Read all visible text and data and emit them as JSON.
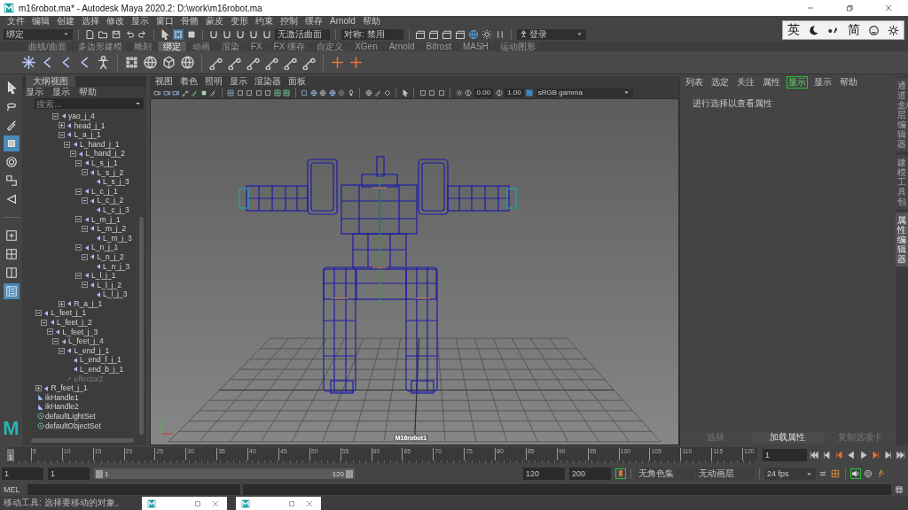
{
  "window": {
    "title": "m16robot.ma* - Autodesk Maya 2020.2: D:\\work\\m16robot.ma"
  },
  "menu_bar": [
    "文件",
    "编辑",
    "创建",
    "选择",
    "修改",
    "显示",
    "窗口",
    "骨骼",
    "蒙皮",
    "变形",
    "约束",
    "控制",
    "缓存",
    "Arnold",
    "帮助"
  ],
  "ime_toolbar": {
    "language": "英",
    "script": "简"
  },
  "status_line": {
    "menu_set": "绑定",
    "live_surface": "无激活曲面",
    "symmetry": "对称: 禁用",
    "login": "登录"
  },
  "shelf": {
    "tabs": [
      {
        "label": "曲线/曲面",
        "selected": false
      },
      {
        "label": "多边形建模",
        "selected": false
      },
      {
        "label": "雕刻",
        "selected": false
      },
      {
        "label": "绑定",
        "selected": true
      },
      {
        "label": "动画",
        "selected": false
      },
      {
        "label": "渲染",
        "selected": false
      },
      {
        "label": "FX",
        "selected": false
      },
      {
        "label": "FX 缓存",
        "selected": false
      },
      {
        "label": "自定义",
        "selected": false
      },
      {
        "label": "XGen",
        "selected": false
      },
      {
        "label": "Arnold",
        "selected": false
      },
      {
        "label": "Bifrost",
        "selected": false
      },
      {
        "label": "MASH",
        "selected": false
      },
      {
        "label": "运动图形",
        "selected": false
      }
    ]
  },
  "toolbox": {
    "tools": [
      {
        "selected": false
      },
      {
        "selected": false
      },
      {
        "selected": false
      },
      {
        "selected": true
      },
      {
        "selected": false
      },
      {
        "selected": false
      },
      {
        "selected": false
      }
    ],
    "layouts": [
      {
        "selected": false
      },
      {
        "selected": false
      },
      {
        "selected": false
      },
      {
        "selected": true
      }
    ],
    "logo": "M"
  },
  "outliner": {
    "title": "大纲视图",
    "menus": [
      "显示",
      "显示",
      "帮助"
    ],
    "search": {
      "placeholder": "搜索..."
    },
    "tree": [
      {
        "children": [
          {
            "children": [
              {
                "children": [
                  {
                    "children": [
                      {
                        "label": "yao_j_4",
                        "kind": "joint",
                        "expanded": true,
                        "children": [
                          {
                            "label": "head_j_1",
                            "kind": "joint",
                            "expanded": false
                          },
                          {
                            "label": "L_a_j_1",
                            "kind": "joint",
                            "expanded": true,
                            "children": [
                              {
                                "label": "L_hand_j_1",
                                "kind": "joint",
                                "expanded": true,
                                "children": [
                                  {
                                    "label": "L_hand_j_2",
                                    "kind": "joint",
                                    "expanded": true,
                                    "children": [
                                      {
                                        "label": "L_s_j_1",
                                        "kind": "joint",
                                        "expanded": true,
                                        "children": [
                                          {
                                            "label": "L_s_j_2",
                                            "kind": "joint",
                                            "expanded": true,
                                            "children": [
                                              {
                                                "label": "L_s_j_3",
                                                "kind": "joint"
                                              }
                                            ]
                                          }
                                        ]
                                      },
                                      {
                                        "label": "L_c_j_1",
                                        "kind": "joint",
                                        "expanded": true,
                                        "children": [
                                          {
                                            "label": "L_c_j_2",
                                            "kind": "joint",
                                            "expanded": true,
                                            "children": [
                                              {
                                                "label": "L_c_j_3",
                                                "kind": "joint"
                                              }
                                            ]
                                          }
                                        ]
                                      },
                                      {
                                        "label": "L_m_j_1",
                                        "kind": "joint",
                                        "expanded": true,
                                        "children": [
                                          {
                                            "label": "L_m_j_2",
                                            "kind": "joint",
                                            "expanded": true,
                                            "children": [
                                              {
                                                "label": "L_m_j_3",
                                                "kind": "joint"
                                              }
                                            ]
                                          }
                                        ]
                                      },
                                      {
                                        "label": "L_n_j_1",
                                        "kind": "joint",
                                        "expanded": true,
                                        "children": [
                                          {
                                            "label": "L_n_j_2",
                                            "kind": "joint",
                                            "expanded": true,
                                            "children": [
                                              {
                                                "label": "L_n_j_3",
                                                "kind": "joint"
                                              }
                                            ]
                                          }
                                        ]
                                      },
                                      {
                                        "label": "L_l_j_1",
                                        "kind": "joint",
                                        "expanded": true,
                                        "children": [
                                          {
                                            "label": "L_l_j_2",
                                            "kind": "joint",
                                            "expanded": true,
                                            "children": [
                                              {
                                                "label": "L_l_j_3",
                                                "kind": "joint"
                                              }
                                            ]
                                          }
                                        ]
                                      }
                                    ]
                                  }
                                ]
                              }
                            ]
                          },
                          {
                            "label": "R_a_j_1",
                            "kind": "joint",
                            "expanded": false
                          }
                        ]
                      }
                    ]
                  }
                ]
              }
            ]
          },
          {
            "label": "L_feet_j_1",
            "kind": "joint",
            "expanded": true,
            "children": [
              {
                "label": "L_feet_j_2",
                "kind": "joint",
                "expanded": true,
                "children": [
                  {
                    "label": "L_feet_j_3",
                    "kind": "joint",
                    "expanded": true,
                    "children": [
                      {
                        "label": "L_feet_j_4",
                        "kind": "joint",
                        "expanded": true,
                        "children": [
                          {
                            "label": "L_end_j_1",
                            "kind": "joint",
                            "expanded": true,
                            "children": [
                              {
                                "label": "L_end_f_j_1",
                                "kind": "joint"
                              },
                              {
                                "label": "L_end_b_j_1",
                                "kind": "joint"
                              }
                            ]
                          },
                          {
                            "label": "effector2",
                            "kind": "effector"
                          }
                        ]
                      }
                    ]
                  }
                ]
              }
            ]
          },
          {
            "label": "R_feet_j_1",
            "kind": "joint",
            "expanded": false
          }
        ]
      },
      {
        "label": "ikHandle1",
        "kind": "ikhandle"
      },
      {
        "label": "ikHandle2",
        "kind": "ikhandle"
      },
      {
        "label": "defaultLightSet",
        "kind": "set"
      },
      {
        "label": "defaultObjectSet",
        "kind": "set"
      }
    ]
  },
  "viewport": {
    "menus": [
      "视图",
      "着色",
      "照明",
      "显示",
      "渲染器",
      "面板"
    ],
    "exposure": "0.00",
    "gamma": "1.00",
    "color_space": "sRGB gamma",
    "object_label": "M16robot1"
  },
  "attribute_editor": {
    "menus": [
      {
        "label": "列表",
        "selected": false
      },
      {
        "label": "选定",
        "selected": false
      },
      {
        "label": "关注",
        "selected": false
      },
      {
        "label": "属性",
        "selected": false
      },
      {
        "label": "显示",
        "selected": true
      },
      {
        "label": "显示",
        "selected": false
      },
      {
        "label": "帮助",
        "selected": false
      }
    ],
    "message": "进行选择以查看属性",
    "buttons": [
      {
        "label": "选择",
        "disabled": true
      },
      {
        "label": "加载属性",
        "disabled": false
      },
      {
        "label": "复制选项卡",
        "disabled": true
      }
    ]
  },
  "side_tabs": [
    {
      "label": "通道盒/层编辑器",
      "selected": false
    },
    {
      "label": "建模工具包",
      "selected": false
    },
    {
      "label": "属性编辑器",
      "selected": true
    }
  ],
  "time_slider": {
    "level": 0,
    "start_marker": "1",
    "ticks": [
      "5",
      "10",
      "15",
      "20",
      "25",
      "30",
      "35",
      "40",
      "45",
      "50",
      "55",
      "60",
      "65",
      "70",
      "75",
      "80",
      "85",
      "90",
      "95",
      "100",
      "105",
      "110",
      "115",
      "120"
    ],
    "current_frame": "1"
  },
  "range_slider": {
    "level": 1,
    "animation_start": "1",
    "playback_start": "1",
    "handle_start": "1",
    "handle_end": "120",
    "playback_end": "120",
    "animation_end": "200",
    "character_set": "无角色集",
    "anim_layer": "无动画层",
    "fps": "24 fps"
  },
  "command_line": {
    "language": "MEL"
  },
  "help_line": "移动工具: 选择要移动的对象。"
}
